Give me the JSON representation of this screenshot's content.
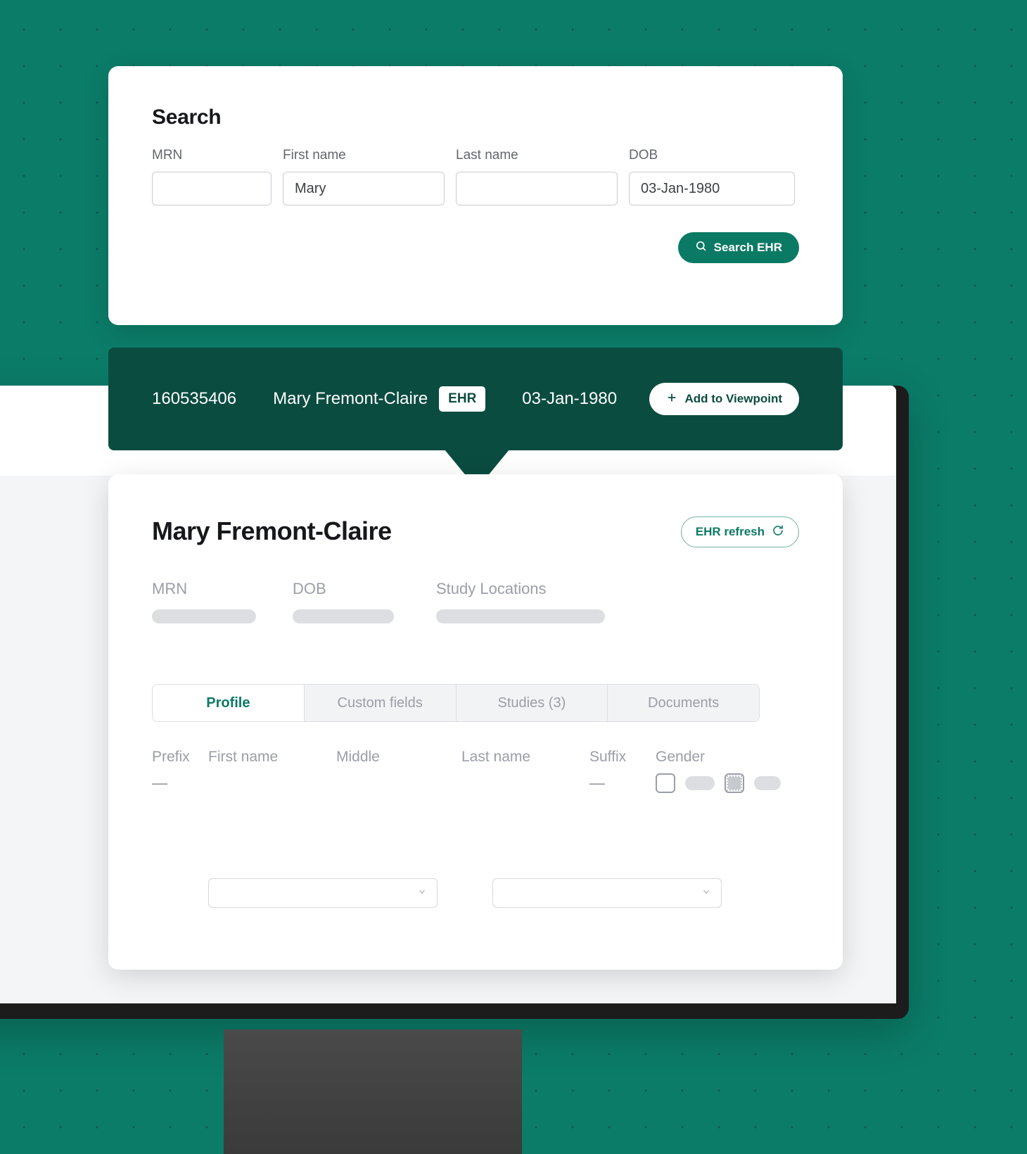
{
  "theme": {
    "background_teal": "#0b7c68",
    "dot_color": "#0a5c4e",
    "banner_green": "#0b4c40",
    "accent_green": "#0b7a64",
    "skeleton_gray": "#dcdee2"
  },
  "search": {
    "title": "Search",
    "fields": [
      {
        "label": "MRN",
        "value": "",
        "placeholder": ""
      },
      {
        "label": "First name",
        "value": "Mary",
        "placeholder": ""
      },
      {
        "label": "Last name",
        "value": "",
        "placeholder": ""
      },
      {
        "label": "DOB",
        "value": "03-Jan-1980",
        "placeholder": ""
      }
    ],
    "calendar_icon": "calendar-icon",
    "submit_label": "Search EHR",
    "submit_icon": "search-icon"
  },
  "banner": {
    "mrn": "160535406",
    "name": "Mary Fremont-Claire",
    "source_badge": "EHR",
    "dob": "03-Jan-1980",
    "action_label": "Add to Viewpoint",
    "action_icon": "plus-icon"
  },
  "patient": {
    "name": "Mary Fremont-Claire",
    "refresh_label": "EHR refresh",
    "refresh_icon": "refresh-icon",
    "summary": [
      {
        "label": "MRN"
      },
      {
        "label": "DOB"
      },
      {
        "label": "Study Locations"
      }
    ],
    "tabs": [
      {
        "label": "Profile",
        "active": true
      },
      {
        "label": "Custom fields",
        "active": false
      },
      {
        "label": "Studies (3)",
        "active": false
      },
      {
        "label": "Documents",
        "active": false
      }
    ],
    "profile_columns": [
      "Prefix",
      "First name",
      "Middle",
      "Last name",
      "Suffix",
      "Gender"
    ],
    "profile_row_1": {
      "prefix": "—",
      "suffix": "—"
    },
    "select_placeholder": "",
    "chevron_icon": "chevron-down-icon"
  }
}
